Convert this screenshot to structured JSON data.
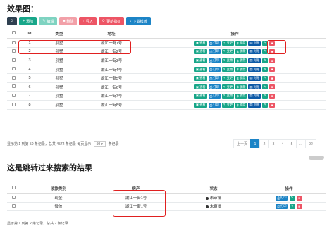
{
  "heading1": "效果图：",
  "heading2": "这是跳转过来搜索的结果",
  "toolbar": {
    "refresh": "⟳",
    "add": "添加",
    "edit": "编辑",
    "delete": "删除",
    "import": "导入",
    "update_status": "更新指标",
    "download_template": "下载模板"
  },
  "table1": {
    "headers": [
      "",
      "Id",
      "类型",
      "地址",
      "操作"
    ],
    "rows": [
      {
        "id": "1",
        "type": "别墅",
        "addr": "湖江一街1号"
      },
      {
        "id": "2",
        "type": "别墅",
        "addr": "湖江一街2号"
      },
      {
        "id": "3",
        "type": "别墅",
        "addr": "湖江一街3号"
      },
      {
        "id": "4",
        "type": "别墅",
        "addr": "湖江一街4号"
      },
      {
        "id": "5",
        "type": "别墅",
        "addr": "湖江一街5号"
      },
      {
        "id": "6",
        "type": "别墅",
        "addr": "湖江一街6号"
      },
      {
        "id": "7",
        "type": "别墅",
        "addr": "湖江一街7号"
      },
      {
        "id": "8",
        "type": "别墅",
        "addr": "湖江一街8号"
      }
    ],
    "ops": {
      "view": "查看",
      "print": "打印",
      "change": "变更",
      "receive": "收款",
      "archive": "对账"
    }
  },
  "footer1": {
    "info": "显示第 1 到第 50 条记录，总共 4572 条记录 每页显示",
    "per_page": "50",
    "per_page_suffix": "条记录"
  },
  "pager": {
    "prev": "上一页",
    "p1": "1",
    "p2": "2",
    "p3": "3",
    "p4": "4",
    "p5": "5",
    "ellipsis": "...",
    "last": "92"
  },
  "table2": {
    "headers": [
      "",
      "收款类别",
      "房产",
      "状态",
      "操作"
    ],
    "rows": [
      {
        "type": "现金",
        "estate": "湖江一街1号",
        "status": "未审批"
      },
      {
        "type": "微信",
        "estate": "湖江一街1号",
        "status": "未审批"
      }
    ],
    "print": "打印"
  },
  "footer2": "显示第 1 到第 2 条记录，总共 2 条记录"
}
